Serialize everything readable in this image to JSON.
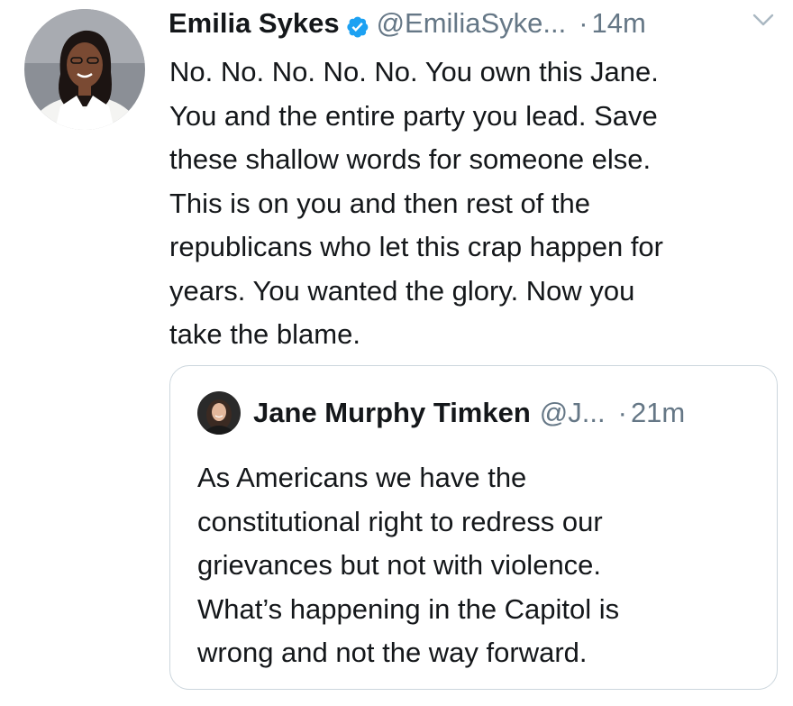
{
  "tweet": {
    "author_name": "Emilia Sykes",
    "handle": "@EmiliaSyke...",
    "separator": "·",
    "time": "14m",
    "body_lines": [
      "No. No. No. No. No. You own this Jane.",
      "You and the entire party you lead. Save",
      "these shallow words for someone else.",
      "This is on you and then rest of the",
      "republicans who let this crap happen for",
      "years. You wanted the glory. Now you",
      "take the blame."
    ],
    "verified_icon": "verified-badge-icon",
    "menu_icon": "chevron-down-icon",
    "accent_color": "#1da1f2"
  },
  "quoted_tweet": {
    "author_name": "Jane Murphy Timken",
    "handle": "@J...",
    "separator": "·",
    "time": "21m",
    "body_lines": [
      "As Americans we have the",
      "constitutional right to redress our",
      "grievances but not with violence.",
      "What’s happening in the Capitol is",
      "wrong and not the way forward."
    ]
  }
}
